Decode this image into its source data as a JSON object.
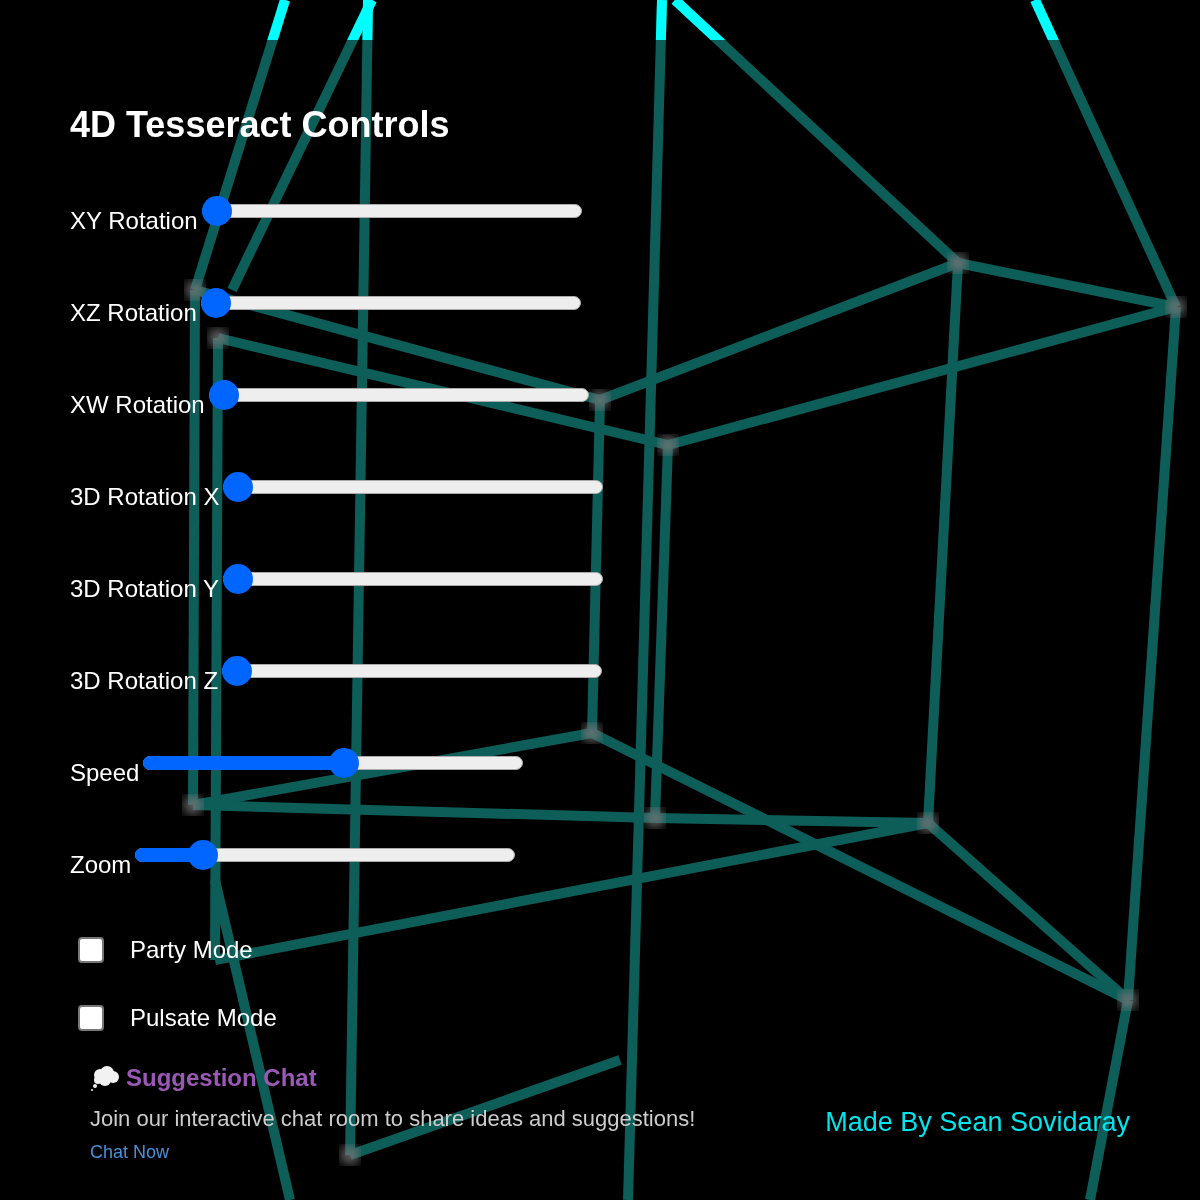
{
  "title": "4D Tesseract Controls",
  "sliders": [
    {
      "label": "XY Rotation",
      "level": 0
    },
    {
      "label": "XZ Rotation",
      "level": 0
    },
    {
      "label": "XW Rotation",
      "level": 0
    },
    {
      "label": "3D Rotation X",
      "level": 0
    },
    {
      "label": "3D Rotation Y",
      "level": 0
    },
    {
      "label": "3D Rotation Z",
      "level": 0
    },
    {
      "label": "Speed",
      "level": 0.53
    },
    {
      "label": "Zoom",
      "level": 0.15
    }
  ],
  "toggles": [
    {
      "label": "Party Mode",
      "checked": false
    },
    {
      "label": "Pulsate Mode",
      "checked": false
    }
  ],
  "suggestion": {
    "title": "Suggestion Chat",
    "text": "Join our interactive chat room to share ideas and suggestions!",
    "link": "Chat Now"
  },
  "credit": "Made By Sean Sovidaray"
}
